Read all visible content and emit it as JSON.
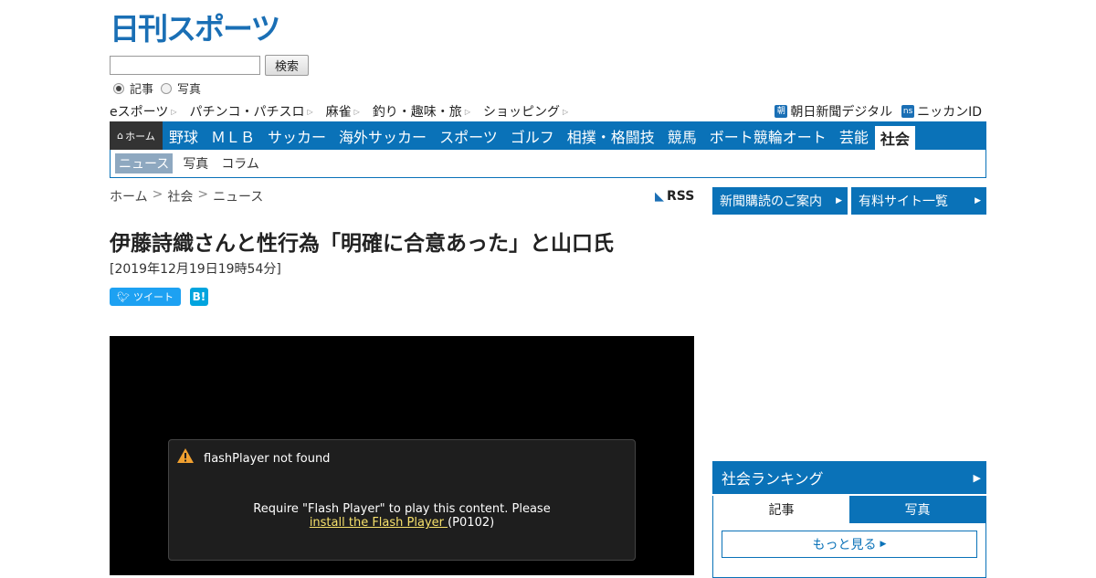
{
  "site": {
    "logo_text": "日刊スポーツ"
  },
  "search": {
    "button": "検索",
    "radio_article": "記事",
    "radio_photo": "写真",
    "value": ""
  },
  "utility": {
    "left": [
      "eスポーツ",
      "パチンコ・パチスロ",
      "麻雀",
      "釣り・趣味・旅",
      "ショッピング"
    ],
    "right": [
      {
        "badge": "朝",
        "label": "朝日新聞デジタル"
      },
      {
        "badge": "ns",
        "label": "ニッカンID"
      }
    ]
  },
  "nav": {
    "home": "ホーム",
    "items": [
      "野球",
      "ＭＬＢ",
      "サッカー",
      "海外サッカー",
      "スポーツ",
      "ゴルフ",
      "相撲・格闘技",
      "競馬",
      "ボート競輪オート",
      "芸能",
      "社会"
    ],
    "active": "社会"
  },
  "subnav": {
    "items": [
      "ニュース",
      "写真",
      "コラム"
    ],
    "active": "ニュース"
  },
  "breadcrumb": {
    "home": "ホーム",
    "section": "社会",
    "current": "ニュース",
    "sep": ">"
  },
  "rss": "RSS",
  "article": {
    "title": "伊藤詩織さんと性行為「明確に合意あった」と山口氏",
    "date": "[2019年12月19日19時54分]"
  },
  "share": {
    "tweet": "ツイート",
    "hatena": "B!"
  },
  "video": {
    "error_title": "flashPlayer not found",
    "error_msg": "Require \"Flash Player\" to play this content. Please",
    "error_link": "install the Flash Player ",
    "error_code": "(P0102)"
  },
  "sidebar": {
    "btn1": "新聞購読のご案内",
    "btn2": "有料サイト一覧",
    "ranking_title": "社会ランキング",
    "tab_article": "記事",
    "tab_photo": "写真",
    "more": "もっと見る"
  },
  "colors": {
    "brand_blue": "#0a72b8",
    "home_bg": "#333333"
  }
}
